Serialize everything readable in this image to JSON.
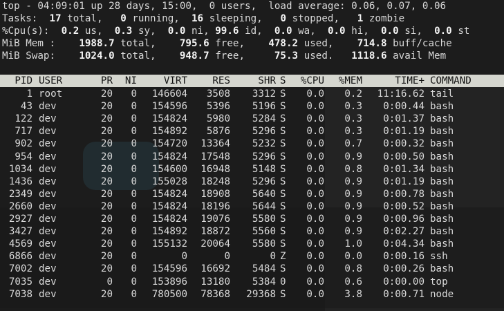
{
  "summary": {
    "line1": "top - 04:09:01 up 28 days, 15:00,  0 users,  load average: 0.06, 0.07, 0.06",
    "tasks": {
      "label": "Tasks:",
      "total": "17",
      "total_lbl": "total,",
      "running": "0",
      "running_lbl": "running,",
      "sleeping": "16",
      "sleeping_lbl": "sleeping,",
      "stopped": "0",
      "stopped_lbl": "stopped,",
      "zombie": "1",
      "zombie_lbl": "zombie"
    },
    "cpu": {
      "label": "%Cpu(s):",
      "us": "0.2",
      "us_lbl": "us,",
      "sy": "0.3",
      "sy_lbl": "sy,",
      "ni": "0.0",
      "ni_lbl": "ni,",
      "id": "99.6",
      "id_lbl": "id,",
      "wa": "0.0",
      "wa_lbl": "wa,",
      "hi": "0.0",
      "hi_lbl": "hi,",
      "si": "0.0",
      "si_lbl": "si,",
      "st": "0.0",
      "st_lbl": "st"
    },
    "mem": {
      "label": "MiB Mem :",
      "total": "1988.7",
      "total_lbl": "total,",
      "free": "795.6",
      "free_lbl": "free,",
      "used": "478.2",
      "used_lbl": "used,",
      "buff": "714.8",
      "buff_lbl": "buff/cache"
    },
    "swap": {
      "label": "MiB Swap:",
      "total": "1024.0",
      "total_lbl": "total,",
      "free": "948.7",
      "free_lbl": "free,",
      "used": "75.3",
      "used_lbl": "used.",
      "avail": "1118.6",
      "avail_lbl": "avail Mem"
    }
  },
  "columns": [
    "PID",
    "USER",
    "PR",
    "NI",
    "VIRT",
    "RES",
    "SHR",
    "S",
    "%CPU",
    "%MEM",
    "TIME+",
    "COMMAND"
  ],
  "processes": [
    [
      "1",
      "root",
      "20",
      "0",
      "146604",
      "3508",
      "3312",
      "S",
      "0.0",
      "0.2",
      "11:16.62",
      "tail"
    ],
    [
      "43",
      "dev",
      "20",
      "0",
      "154596",
      "5396",
      "5196",
      "S",
      "0.0",
      "0.3",
      "0:00.44",
      "bash"
    ],
    [
      "122",
      "dev",
      "20",
      "0",
      "154824",
      "5980",
      "5284",
      "S",
      "0.0",
      "0.3",
      "0:01.37",
      "bash"
    ],
    [
      "717",
      "dev",
      "20",
      "0",
      "154892",
      "5876",
      "5296",
      "S",
      "0.0",
      "0.3",
      "0:01.19",
      "bash"
    ],
    [
      "902",
      "dev",
      "20",
      "0",
      "154720",
      "13364",
      "5232",
      "S",
      "0.0",
      "0.7",
      "0:00.32",
      "bash"
    ],
    [
      "954",
      "dev",
      "20",
      "0",
      "154824",
      "17548",
      "5296",
      "S",
      "0.0",
      "0.9",
      "0:00.50",
      "bash"
    ],
    [
      "1034",
      "dev",
      "20",
      "0",
      "154600",
      "16948",
      "5148",
      "S",
      "0.0",
      "0.8",
      "0:01.34",
      "bash"
    ],
    [
      "1436",
      "dev",
      "20",
      "0",
      "155028",
      "18248",
      "5296",
      "S",
      "0.0",
      "0.9",
      "0:01.19",
      "bash"
    ],
    [
      "2349",
      "dev",
      "20",
      "0",
      "154824",
      "18908",
      "5640",
      "S",
      "0.0",
      "0.9",
      "0:00.78",
      "bash"
    ],
    [
      "2660",
      "dev",
      "20",
      "0",
      "154824",
      "18196",
      "5644",
      "S",
      "0.0",
      "0.9",
      "0:00.52",
      "bash"
    ],
    [
      "2927",
      "dev",
      "20",
      "0",
      "154824",
      "19076",
      "5580",
      "S",
      "0.0",
      "0.9",
      "0:00.96",
      "bash"
    ],
    [
      "3427",
      "dev",
      "20",
      "0",
      "154892",
      "18872",
      "5560",
      "S",
      "0.0",
      "0.9",
      "0:02.27",
      "bash"
    ],
    [
      "4569",
      "dev",
      "20",
      "0",
      "155132",
      "20064",
      "5580",
      "S",
      "0.0",
      "1.0",
      "0:04.34",
      "bash"
    ],
    [
      "6866",
      "dev",
      "20",
      "0",
      "0",
      "0",
      "0",
      "Z",
      "0.0",
      "0.0",
      "0:00.16",
      "ssh"
    ],
    [
      "7002",
      "dev",
      "20",
      "0",
      "154596",
      "16692",
      "5484",
      "S",
      "0.0",
      "0.8",
      "0:00.26",
      "bash"
    ],
    [
      "7035",
      "dev",
      "0",
      "0",
      "153896",
      "13180",
      "5384",
      "0",
      "0.0",
      "0.6",
      "0:00.00",
      "top"
    ],
    [
      "7038",
      "dev",
      "20",
      "0",
      "780500",
      "78368",
      "29368",
      "S",
      "0.0",
      "3.8",
      "0:00.71",
      "node"
    ]
  ]
}
